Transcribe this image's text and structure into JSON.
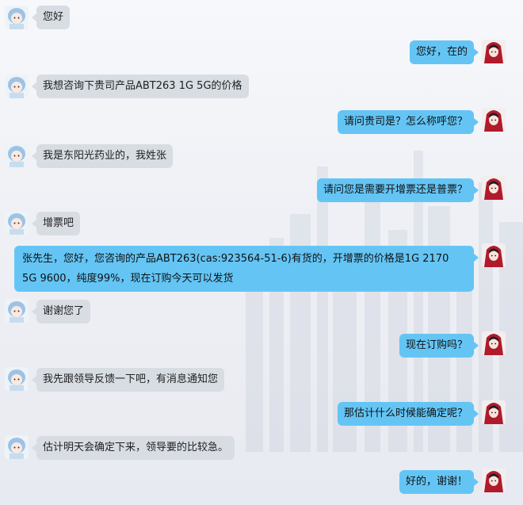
{
  "messages": [
    {
      "side": "left",
      "text": "您好"
    },
    {
      "side": "right",
      "text": "您好，在的"
    },
    {
      "side": "left",
      "text": "我想咨询下贵司产品ABT263 1G 5G的价格"
    },
    {
      "side": "right",
      "text": "请问贵司是？怎么称呼您？"
    },
    {
      "side": "left",
      "text": "我是东阳光药业的，我姓张"
    },
    {
      "side": "right",
      "text": "请问您是需要开增票还是普票？"
    },
    {
      "side": "left",
      "text": "增票吧"
    },
    {
      "side": "right",
      "line1": "张先生，您好，您咨询的产品ABT263(cas:923564-51-6)有货的，开增票的价格是1G 2170",
      "line2": "5G 9600，纯度99%，现在订购今天可以发货"
    },
    {
      "side": "left",
      "text": "谢谢您了"
    },
    {
      "side": "right",
      "text": "现在订购吗？"
    },
    {
      "side": "left",
      "text": "我先跟领导反馈一下吧，有消息通知您"
    },
    {
      "side": "right",
      "text": "那估计什么时候能确定呢？"
    },
    {
      "side": "left",
      "text": "估计明天会确定下来，领导要的比较急。"
    },
    {
      "side": "right",
      "text": "好的，谢谢！"
    }
  ],
  "colors": {
    "left_bubble": "#d7dde3",
    "right_bubble": "#64c5f5"
  },
  "icons": {
    "left_avatar": "cartoon-girl-avatar-icon",
    "right_avatar": "red-hood-anime-avatar-icon"
  }
}
